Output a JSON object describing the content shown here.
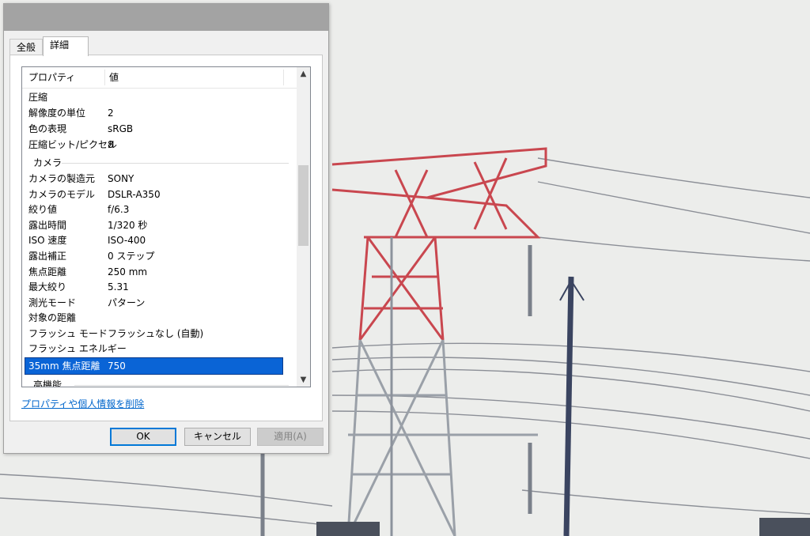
{
  "dialog": {
    "tabs": [
      {
        "label": "全般",
        "active": false
      },
      {
        "label": "詳細",
        "active": true
      }
    ],
    "list": {
      "header": {
        "name": "プロパティ",
        "value": "値"
      },
      "rows_top": [
        {
          "name": "圧縮",
          "value": ""
        },
        {
          "name": "解像度の単位",
          "value": "2"
        },
        {
          "name": "色の表現",
          "value": "sRGB"
        },
        {
          "name": "圧縮ビット/ピクセル",
          "value": "8"
        }
      ],
      "group_camera": "カメラ",
      "rows_camera": [
        {
          "name": "カメラの製造元",
          "value": "SONY"
        },
        {
          "name": "カメラのモデル",
          "value": "DSLR-A350"
        },
        {
          "name": "絞り値",
          "value": "f/6.3"
        },
        {
          "name": "露出時間",
          "value": "1/320 秒"
        },
        {
          "name": "ISO 速度",
          "value": "ISO-400"
        },
        {
          "name": "露出補正",
          "value": "0 ステップ"
        },
        {
          "name": "焦点距離",
          "value": "250 mm"
        },
        {
          "name": "最大絞り",
          "value": "5.31"
        },
        {
          "name": "測光モード",
          "value": "パターン"
        },
        {
          "name": "対象の距離",
          "value": ""
        },
        {
          "name": "フラッシュ モード",
          "value": "フラッシュなし (自動)"
        },
        {
          "name": "フラッシュ エネルギー",
          "value": ""
        }
      ],
      "selected_row": {
        "name": "35mm 焦点距離",
        "value": "750"
      },
      "group_next": "高機能"
    },
    "remove_link": "プロパティや個人情報を削除",
    "buttons": {
      "ok": "OK",
      "cancel": "キャンセル",
      "apply": "適用(A)"
    }
  },
  "colors": {
    "selection": "#0a64d6",
    "link": "#0066cc",
    "default_button_border": "#0078d7"
  }
}
